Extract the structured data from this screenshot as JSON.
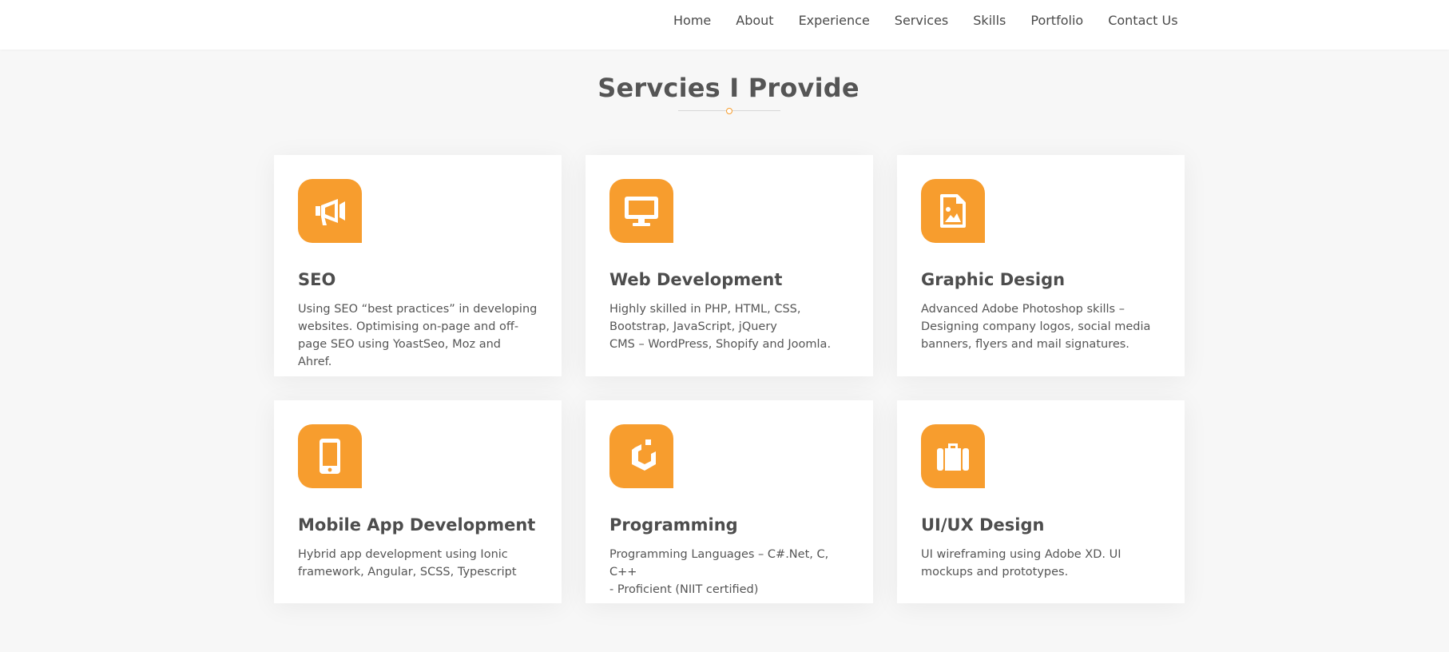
{
  "nav": {
    "items": [
      "Home",
      "About",
      "Experience",
      "Services",
      "Skills",
      "Portfolio",
      "Contact Us"
    ]
  },
  "section": {
    "title": "Servcies I Provide"
  },
  "colors": {
    "accent": "#f79d2e",
    "card_bg": "#ffffff",
    "page_bg": "#f7f7f7",
    "text": "#555555"
  },
  "services": [
    {
      "icon": "megaphone-icon",
      "title": "SEO",
      "text": "Using SEO “best practices” in developing\nwebsites. Optimising on-page and off-\npage SEO using YoastSeo, Moz and Ahref."
    },
    {
      "icon": "desktop-icon",
      "title": "Web Development",
      "text": "Highly skilled in PHP, HTML, CSS,\nBootstrap, JavaScript, jQuery\nCMS – WordPress, Shopify and Joomla."
    },
    {
      "icon": "image-file-icon",
      "title": "Graphic Design",
      "text": "Advanced Adobe Photoshop skills –\nDesigning company logos, social media\nbanners, flyers and mail signatures."
    },
    {
      "icon": "mobile-phone-icon",
      "title": "Mobile App Development",
      "text": "Hybrid app development using Ionic\nframework, Angular, SCSS, Typescript"
    },
    {
      "icon": "cube-logo-icon",
      "title": "Programming",
      "text": "Programming Languages – C#.Net, C, C++\n- Proficient (NIIT certified)"
    },
    {
      "icon": "suitcase-icon",
      "title": "UI/UX Design",
      "text": "UI wireframing using Adobe XD. UI\nmockups and prototypes."
    }
  ]
}
